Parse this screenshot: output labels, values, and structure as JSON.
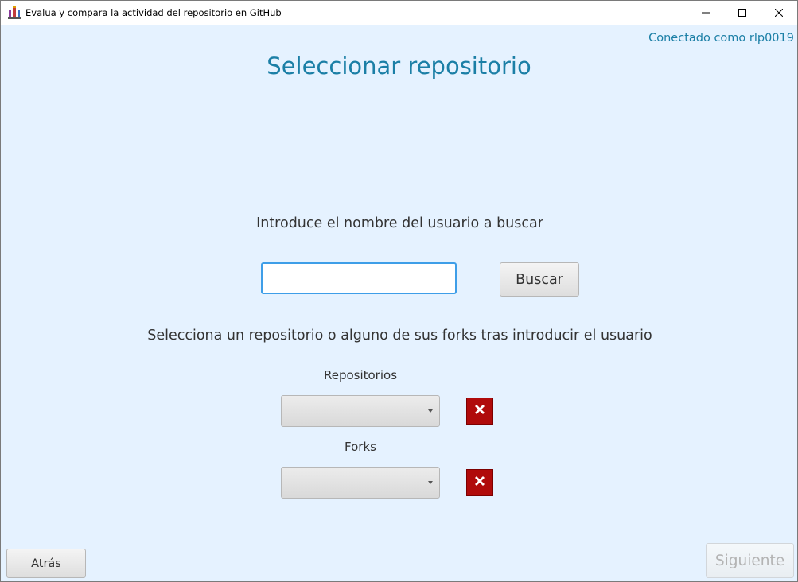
{
  "window": {
    "title": "Evalua y compara la actividad del repositorio en GitHub",
    "controls": {
      "minimize_icon": "minimize-icon",
      "maximize_icon": "maximize-icon",
      "close_icon": "close-icon"
    }
  },
  "header": {
    "connected_text": "Conectado como rlp0019",
    "page_title": "Seleccionar repositorio"
  },
  "search": {
    "prompt": "Introduce el nombre del usuario a buscar",
    "input_value": "",
    "button_label": "Buscar"
  },
  "selection": {
    "instruction": "Selecciona un repositorio o alguno de sus forks tras introducir el usuario",
    "repositories_label": "Repositorios",
    "repositories_selected": "",
    "forks_label": "Forks",
    "forks_selected": "",
    "clear_icon": "clear-x-icon"
  },
  "footer": {
    "back_label": "Atrás",
    "next_label": "Siguiente",
    "next_enabled": false
  },
  "colors": {
    "accent": "#1b7fa6",
    "background": "#e5f2ff",
    "clear_button": "#b00b0b",
    "focus_border": "#3e9ee8"
  }
}
